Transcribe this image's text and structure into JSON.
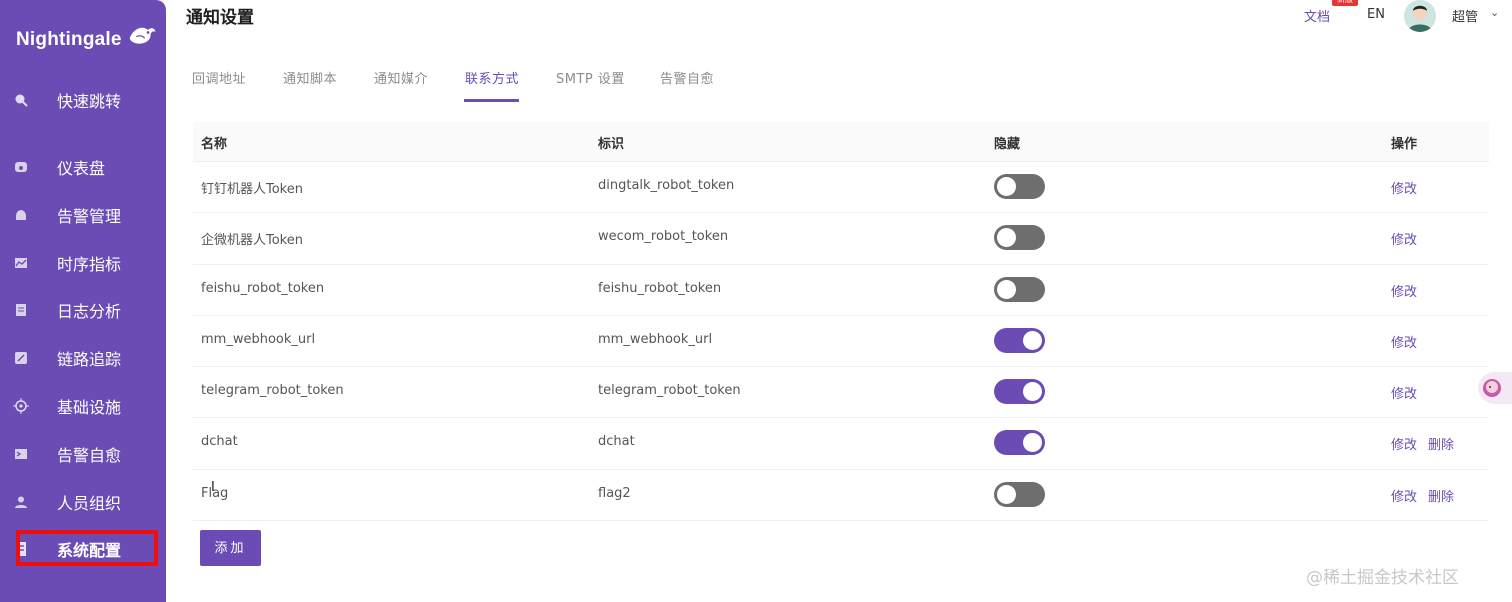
{
  "app": {
    "logo_text": "Nightingale"
  },
  "colors": {
    "brand": "#6a4cb4",
    "switch_off": "#6e6e6e",
    "highlight": "#f20d0d",
    "badge": "#e83333"
  },
  "sidebar": {
    "items": [
      {
        "label": "快速跳转",
        "icon": "search-icon"
      },
      {
        "label": "仪表盘",
        "icon": "dashboard-icon"
      },
      {
        "label": "告警管理",
        "icon": "alarm-bell-icon"
      },
      {
        "label": "时序指标",
        "icon": "line-chart-icon"
      },
      {
        "label": "日志分析",
        "icon": "log-document-icon"
      },
      {
        "label": "链路追踪",
        "icon": "trace-icon"
      },
      {
        "label": "基础设施",
        "icon": "infrastructure-icon"
      },
      {
        "label": "告警自愈",
        "icon": "terminal-icon"
      },
      {
        "label": "人员组织",
        "icon": "user-icon"
      },
      {
        "label": "系统配置",
        "icon": "settings-icon",
        "active": true
      }
    ]
  },
  "header": {
    "title": "通知设置",
    "docs_label": "文档",
    "docs_badge": "新版",
    "lang": "EN",
    "user_name": "超管"
  },
  "tabs": [
    {
      "label": "回调地址"
    },
    {
      "label": "通知脚本"
    },
    {
      "label": "通知媒介"
    },
    {
      "label": "联系方式",
      "active": true
    },
    {
      "label": "SMTP 设置"
    },
    {
      "label": "告警自愈"
    }
  ],
  "table": {
    "columns": [
      "名称",
      "标识",
      "隐藏",
      "操作"
    ],
    "rows": [
      {
        "name": "钉钉机器人Token",
        "ident": "dingtalk_robot_token",
        "hidden": false,
        "actions": [
          "修改"
        ]
      },
      {
        "name": "企微机器人Token",
        "ident": "wecom_robot_token",
        "hidden": false,
        "actions": [
          "修改"
        ]
      },
      {
        "name": "feishu_robot_token",
        "ident": "feishu_robot_token",
        "hidden": false,
        "actions": [
          "修改"
        ]
      },
      {
        "name": "mm_webhook_url",
        "ident": "mm_webhook_url",
        "hidden": true,
        "actions": [
          "修改"
        ]
      },
      {
        "name": "telegram_robot_token",
        "ident": "telegram_robot_token",
        "hidden": true,
        "actions": [
          "修改"
        ]
      },
      {
        "name": "dchat",
        "ident": "dchat",
        "hidden": true,
        "actions": [
          "修改",
          "删除"
        ]
      },
      {
        "name": "Flag",
        "ident": "flag2",
        "hidden": false,
        "actions": [
          "修改",
          "删除"
        ]
      }
    ]
  },
  "add_button": {
    "label": "添加"
  },
  "watermark": "@稀土掘金技术社区"
}
